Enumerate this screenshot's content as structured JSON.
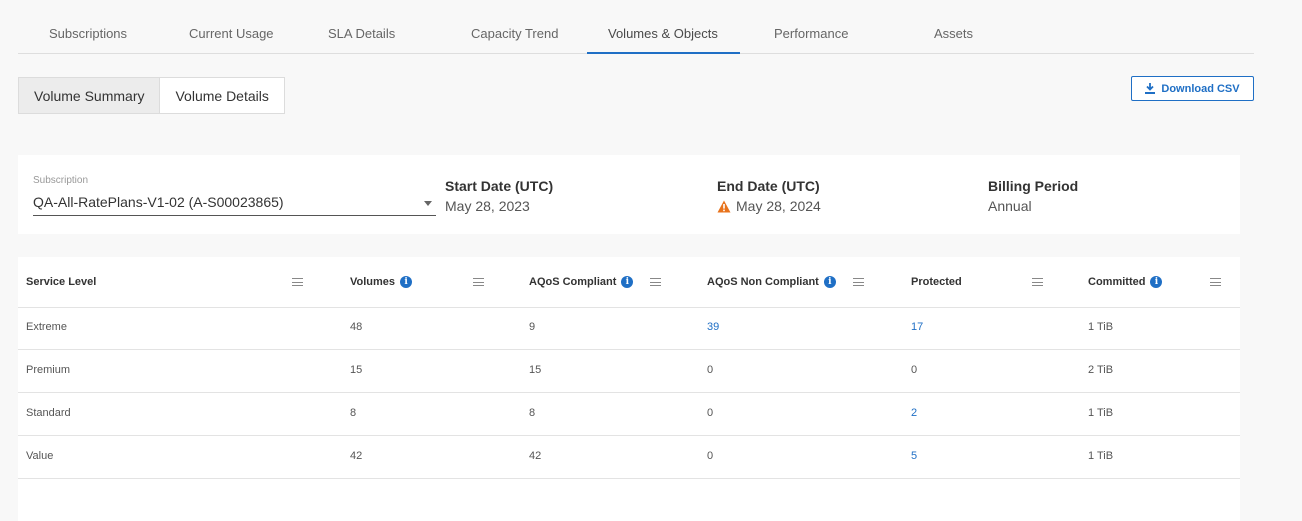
{
  "tabs": [
    {
      "label": "Subscriptions"
    },
    {
      "label": "Current Usage"
    },
    {
      "label": "SLA Details"
    },
    {
      "label": "Capacity Trend"
    },
    {
      "label": "Volumes & Objects",
      "active": true
    },
    {
      "label": "Performance"
    },
    {
      "label": "Assets"
    }
  ],
  "segment": {
    "summary": "Volume Summary",
    "details": "Volume Details",
    "active": "summary"
  },
  "toolbar": {
    "download_label": "Download CSV",
    "download_icon": "download-icon"
  },
  "subscription": {
    "label": "Subscription",
    "value": "QA-All-RatePlans-V1-02 (A-S00023865)"
  },
  "start_date": {
    "title": "Start Date (UTC)",
    "value": "May 28, 2023"
  },
  "end_date": {
    "title": "End Date (UTC)",
    "value": "May 28, 2024",
    "warning_icon": "warning-icon"
  },
  "billing": {
    "title": "Billing Period",
    "value": "Annual"
  },
  "colors": {
    "accent": "#1f6fc5",
    "warning": "#e8731c"
  },
  "table": {
    "columns": [
      {
        "label": "Service Level",
        "info": false
      },
      {
        "label": "Volumes",
        "info": true
      },
      {
        "label": "AQoS Compliant",
        "info": true
      },
      {
        "label": "AQoS Non Compliant",
        "info": true
      },
      {
        "label": "Protected",
        "info": false
      },
      {
        "label": "Committed",
        "info": true
      }
    ],
    "info_glyph": "i",
    "rows": [
      {
        "level": "Extreme",
        "volumes": "48",
        "compliant": "9",
        "non_compliant": "39",
        "protected": "17",
        "committed": "1 TiB"
      },
      {
        "level": "Premium",
        "volumes": "15",
        "compliant": "15",
        "non_compliant": "0",
        "protected": "0",
        "committed": "2 TiB"
      },
      {
        "level": "Standard",
        "volumes": "8",
        "compliant": "8",
        "non_compliant": "0",
        "protected": "2",
        "committed": "1 TiB"
      },
      {
        "level": "Value",
        "volumes": "42",
        "compliant": "42",
        "non_compliant": "0",
        "protected": "5",
        "committed": "1 TiB"
      }
    ]
  }
}
